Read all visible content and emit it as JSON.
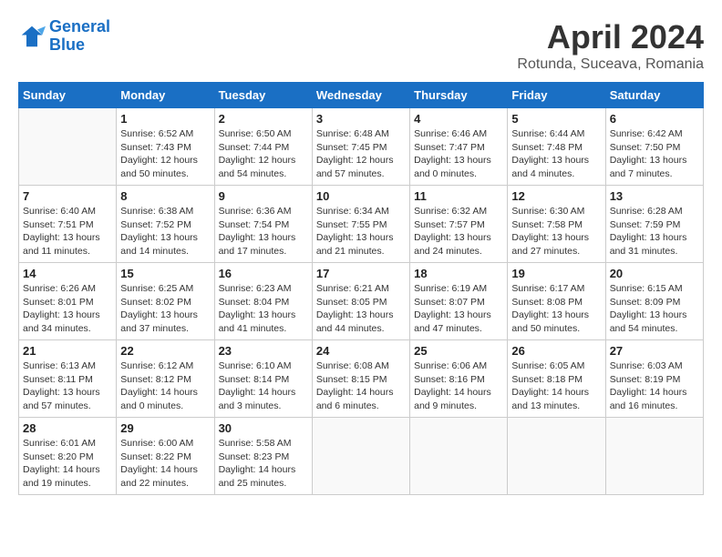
{
  "header": {
    "logo_line1": "General",
    "logo_line2": "Blue",
    "month_title": "April 2024",
    "subtitle": "Rotunda, Suceava, Romania"
  },
  "days_of_week": [
    "Sunday",
    "Monday",
    "Tuesday",
    "Wednesday",
    "Thursday",
    "Friday",
    "Saturday"
  ],
  "weeks": [
    [
      {
        "day": "",
        "info": ""
      },
      {
        "day": "1",
        "info": "Sunrise: 6:52 AM\nSunset: 7:43 PM\nDaylight: 12 hours\nand 50 minutes."
      },
      {
        "day": "2",
        "info": "Sunrise: 6:50 AM\nSunset: 7:44 PM\nDaylight: 12 hours\nand 54 minutes."
      },
      {
        "day": "3",
        "info": "Sunrise: 6:48 AM\nSunset: 7:45 PM\nDaylight: 12 hours\nand 57 minutes."
      },
      {
        "day": "4",
        "info": "Sunrise: 6:46 AM\nSunset: 7:47 PM\nDaylight: 13 hours\nand 0 minutes."
      },
      {
        "day": "5",
        "info": "Sunrise: 6:44 AM\nSunset: 7:48 PM\nDaylight: 13 hours\nand 4 minutes."
      },
      {
        "day": "6",
        "info": "Sunrise: 6:42 AM\nSunset: 7:50 PM\nDaylight: 13 hours\nand 7 minutes."
      }
    ],
    [
      {
        "day": "7",
        "info": "Sunrise: 6:40 AM\nSunset: 7:51 PM\nDaylight: 13 hours\nand 11 minutes."
      },
      {
        "day": "8",
        "info": "Sunrise: 6:38 AM\nSunset: 7:52 PM\nDaylight: 13 hours\nand 14 minutes."
      },
      {
        "day": "9",
        "info": "Sunrise: 6:36 AM\nSunset: 7:54 PM\nDaylight: 13 hours\nand 17 minutes."
      },
      {
        "day": "10",
        "info": "Sunrise: 6:34 AM\nSunset: 7:55 PM\nDaylight: 13 hours\nand 21 minutes."
      },
      {
        "day": "11",
        "info": "Sunrise: 6:32 AM\nSunset: 7:57 PM\nDaylight: 13 hours\nand 24 minutes."
      },
      {
        "day": "12",
        "info": "Sunrise: 6:30 AM\nSunset: 7:58 PM\nDaylight: 13 hours\nand 27 minutes."
      },
      {
        "day": "13",
        "info": "Sunrise: 6:28 AM\nSunset: 7:59 PM\nDaylight: 13 hours\nand 31 minutes."
      }
    ],
    [
      {
        "day": "14",
        "info": "Sunrise: 6:26 AM\nSunset: 8:01 PM\nDaylight: 13 hours\nand 34 minutes."
      },
      {
        "day": "15",
        "info": "Sunrise: 6:25 AM\nSunset: 8:02 PM\nDaylight: 13 hours\nand 37 minutes."
      },
      {
        "day": "16",
        "info": "Sunrise: 6:23 AM\nSunset: 8:04 PM\nDaylight: 13 hours\nand 41 minutes."
      },
      {
        "day": "17",
        "info": "Sunrise: 6:21 AM\nSunset: 8:05 PM\nDaylight: 13 hours\nand 44 minutes."
      },
      {
        "day": "18",
        "info": "Sunrise: 6:19 AM\nSunset: 8:07 PM\nDaylight: 13 hours\nand 47 minutes."
      },
      {
        "day": "19",
        "info": "Sunrise: 6:17 AM\nSunset: 8:08 PM\nDaylight: 13 hours\nand 50 minutes."
      },
      {
        "day": "20",
        "info": "Sunrise: 6:15 AM\nSunset: 8:09 PM\nDaylight: 13 hours\nand 54 minutes."
      }
    ],
    [
      {
        "day": "21",
        "info": "Sunrise: 6:13 AM\nSunset: 8:11 PM\nDaylight: 13 hours\nand 57 minutes."
      },
      {
        "day": "22",
        "info": "Sunrise: 6:12 AM\nSunset: 8:12 PM\nDaylight: 14 hours\nand 0 minutes."
      },
      {
        "day": "23",
        "info": "Sunrise: 6:10 AM\nSunset: 8:14 PM\nDaylight: 14 hours\nand 3 minutes."
      },
      {
        "day": "24",
        "info": "Sunrise: 6:08 AM\nSunset: 8:15 PM\nDaylight: 14 hours\nand 6 minutes."
      },
      {
        "day": "25",
        "info": "Sunrise: 6:06 AM\nSunset: 8:16 PM\nDaylight: 14 hours\nand 9 minutes."
      },
      {
        "day": "26",
        "info": "Sunrise: 6:05 AM\nSunset: 8:18 PM\nDaylight: 14 hours\nand 13 minutes."
      },
      {
        "day": "27",
        "info": "Sunrise: 6:03 AM\nSunset: 8:19 PM\nDaylight: 14 hours\nand 16 minutes."
      }
    ],
    [
      {
        "day": "28",
        "info": "Sunrise: 6:01 AM\nSunset: 8:20 PM\nDaylight: 14 hours\nand 19 minutes."
      },
      {
        "day": "29",
        "info": "Sunrise: 6:00 AM\nSunset: 8:22 PM\nDaylight: 14 hours\nand 22 minutes."
      },
      {
        "day": "30",
        "info": "Sunrise: 5:58 AM\nSunset: 8:23 PM\nDaylight: 14 hours\nand 25 minutes."
      },
      {
        "day": "",
        "info": ""
      },
      {
        "day": "",
        "info": ""
      },
      {
        "day": "",
        "info": ""
      },
      {
        "day": "",
        "info": ""
      }
    ]
  ]
}
